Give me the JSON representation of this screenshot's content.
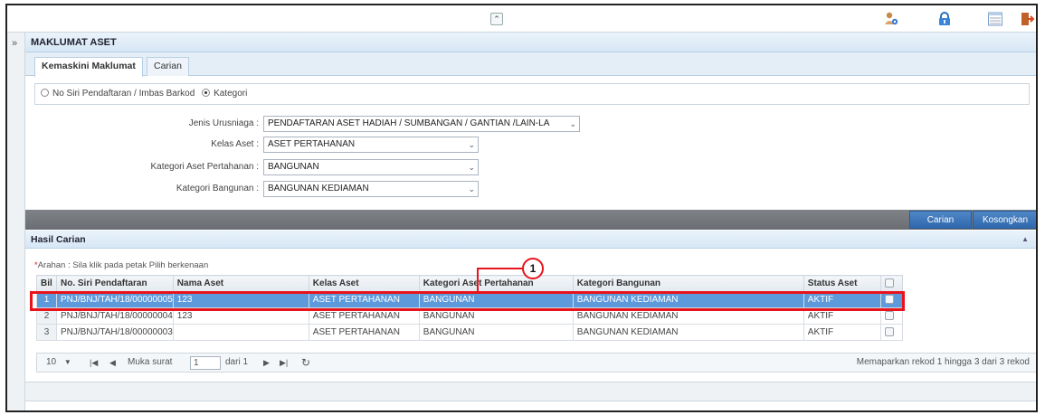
{
  "panel": {
    "title": "MAKLUMAT ASET"
  },
  "tabs": [
    "Kemaskini Maklumat",
    "Carian"
  ],
  "radio": {
    "option1": "No Siri Pendaftaran / Imbas Barkod",
    "option2": "Kategori",
    "selected": "Kategori"
  },
  "form": {
    "jenis_label": "Jenis Urusniaga :",
    "jenis_value": "PENDAFTARAN ASET HADIAH / SUMBANGAN / GANTIAN /LAIN-LA",
    "kelas_label": "Kelas Aset :",
    "kelas_value": "ASET PERTAHANAN",
    "kategori_label": "Kategori Aset Pertahanan :",
    "kategori_value": "BANGUNAN",
    "bangunan_label": "Kategori Bangunan :",
    "bangunan_value": "BANGUNAN KEDIAMAN"
  },
  "buttons": {
    "carian": "Carian",
    "kosongkan": "Kosongkan"
  },
  "results": {
    "title": "Hasil Carian",
    "hint_star": "*",
    "hint": "Arahan : Sila klik pada petak Pilih berkenaan",
    "columns": [
      "Bil",
      "No. Siri Pendaftaran",
      "Nama Aset",
      "Kelas Aset",
      "Kategori Aset Pertahanan",
      "Kategori Bangunan",
      "Status Aset"
    ],
    "rows": [
      {
        "bil": "1",
        "no_siri": "PNJ/BNJ/TAH/18/00000005",
        "nama": "123",
        "kelas": "ASET PERTAHANAN",
        "kategori": "BANGUNAN",
        "bangunan": "BANGUNAN KEDIAMAN",
        "status": "AKTIF"
      },
      {
        "bil": "2",
        "no_siri": "PNJ/BNJ/TAH/18/00000004",
        "nama": "123",
        "kelas": "ASET PERTAHANAN",
        "kategori": "BANGUNAN",
        "bangunan": "BANGUNAN KEDIAMAN",
        "status": "AKTIF"
      },
      {
        "bil": "3",
        "no_siri": "PNJ/BNJ/TAH/18/00000003",
        "nama": "",
        "kelas": "ASET PERTAHANAN",
        "kategori": "BANGUNAN",
        "bangunan": "BANGUNAN KEDIAMAN",
        "status": "AKTIF"
      }
    ],
    "selected_row": 1
  },
  "pager": {
    "page_size": "10",
    "page_label": "Muka surat",
    "page_value": "1",
    "of_label": "dari 1",
    "summary": "Memaparkan rekod 1 hingga 3 dari 3 rekod"
  },
  "callout": {
    "number": "1"
  },
  "colors": {
    "accent": "#2f69ad",
    "selection": "#5d9adb",
    "highlight": "#e8131b"
  },
  "icons": {
    "top": [
      "collapse-up-icon",
      "user-settings-icon",
      "lock-icon",
      "calendar-icon",
      "logout-icon"
    ]
  }
}
